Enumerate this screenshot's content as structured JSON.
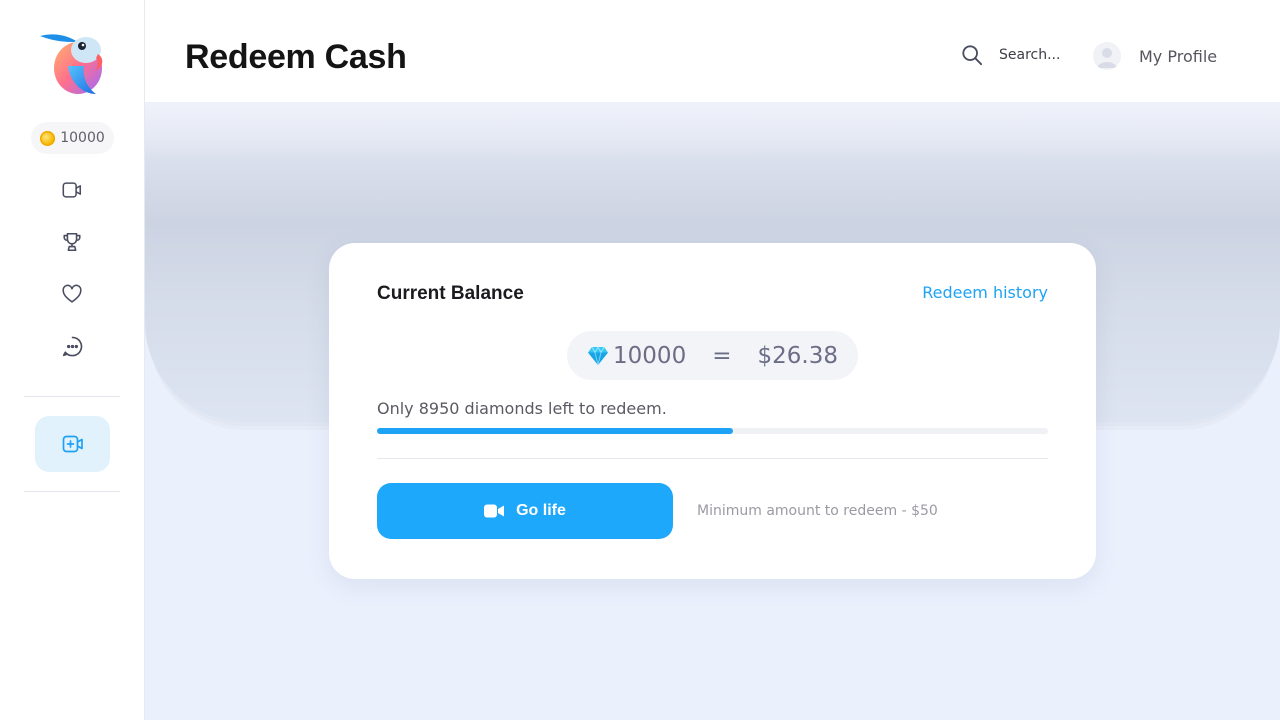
{
  "header": {
    "title": "Redeem Cash",
    "search_label": "Search...",
    "profile_label": "My Profile"
  },
  "sidebar": {
    "coin_balance": "10000",
    "items": [
      {
        "name": "video-icon"
      },
      {
        "name": "trophy-icon"
      },
      {
        "name": "heart-icon"
      },
      {
        "name": "chat-icon"
      }
    ],
    "add_button_icon": "add-video-icon"
  },
  "card": {
    "title": "Current Balance",
    "history_link": "Redeem history",
    "diamonds": "10000",
    "equals": "=",
    "cash_value": "$26.38",
    "remaining_text": "Only 8950 diamonds left to redeem.",
    "progress_fraction": 0.53,
    "go_button_label": "Go life",
    "min_note": "Minimum amount to redeem - $50"
  },
  "colors": {
    "accent": "#1ea2f5",
    "button": "#1ea8fb",
    "background": "#ebf0fd"
  }
}
